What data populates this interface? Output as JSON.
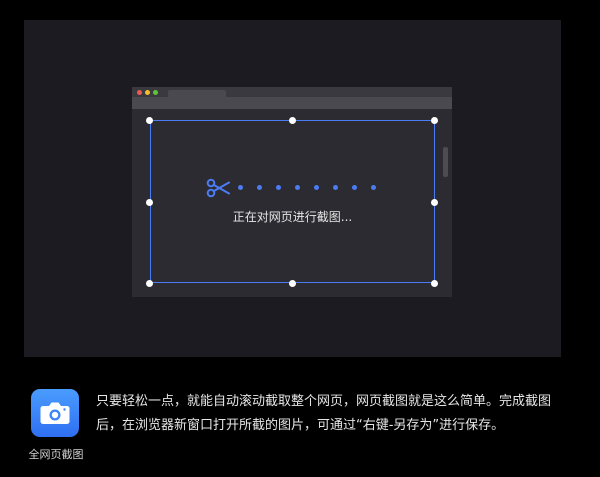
{
  "capture": {
    "status_text": "正在对网页进行截图..."
  },
  "app": {
    "name": "全网页截图",
    "icon": "camera-icon",
    "description": "只要轻松一点，就能自动滚动截取整个网页，网页截图就是这么简单。完成截图后，在浏览器新窗口打开所截的图片，可通过“右键-另存为”进行保存。"
  },
  "colors": {
    "accent": "#4b7cf3",
    "stage_bg": "#1c1b21",
    "browser_bg": "#2c2b31",
    "icon_gradient_top": "#4a9cff",
    "icon_gradient_bottom": "#2f6ff2"
  }
}
